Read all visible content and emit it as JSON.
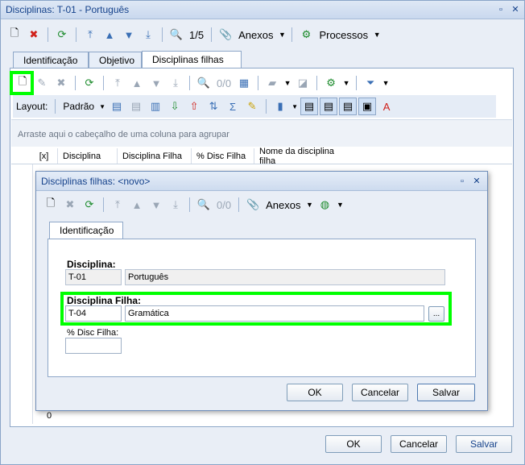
{
  "window": {
    "title": "Disciplinas: T-01 - Português"
  },
  "main_toolbar": {
    "record_count": "1/5",
    "anexos": "Anexos",
    "processos": "Processos"
  },
  "tabs": [
    "Identificação",
    "Objetivo",
    "Disciplinas filhas"
  ],
  "grid_toolbar": {
    "count": "0/0"
  },
  "layout_bar": {
    "layout_label": "Layout:",
    "layout_value": "Padrão"
  },
  "grid": {
    "group_hint": "Arraste aqui o cabeçalho de uma coluna para agrupar",
    "columns": [
      "[x]",
      "Disciplina",
      "Disciplina Filha",
      "% Disc Filha",
      "Nome da disciplina filha"
    ],
    "footer_value": "0"
  },
  "dialog": {
    "title": "Disciplinas filhas: <novo>",
    "toolbar": {
      "count": "0/0",
      "anexos": "Anexos"
    },
    "tab": "Identificação",
    "disciplina_label": "Disciplina:",
    "disciplina_code": "T-01",
    "disciplina_name": "Português",
    "filha_label": "Disciplina Filha:",
    "filha_code": "T-04",
    "filha_name": "Gramática",
    "browse": "...",
    "pct_label": "% Disc Filha:",
    "pct_value": "",
    "ok": "OK",
    "cancel": "Cancelar",
    "save": "Salvar"
  },
  "buttons": {
    "ok": "OK",
    "cancel": "Cancelar",
    "save": "Salvar"
  }
}
